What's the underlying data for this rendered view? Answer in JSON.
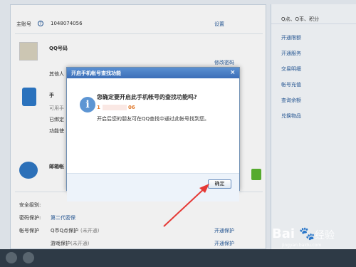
{
  "account": {
    "label": "主账号",
    "help": "?",
    "number": "1048074056",
    "settings_link": "设置"
  },
  "qq_row": {
    "title": "QQ号码",
    "sub": "其他人",
    "link": "修改密码"
  },
  "phone_row": {
    "name_prefix": "手",
    "lines": [
      "可用手",
      "已绑定",
      "功能使"
    ]
  },
  "mail_row": {
    "title": "邮箱帐"
  },
  "security": {
    "level_label": "安全级别:",
    "pwd_protect_label": "密码保护:",
    "pwd_protect_value": "第二代密保",
    "account_protect_label": "帐号保护",
    "items": [
      {
        "name": "Q币Q点保护",
        "status": "(未开通)",
        "action": "开通保护"
      },
      {
        "name": "游戏保护",
        "status": "(未开通)",
        "action": "开通保护"
      }
    ]
  },
  "right_panel": {
    "header": "Q点、Q币、积分",
    "items": [
      "开通限额",
      "开通服务",
      "交易明细",
      "帐号充值",
      "查询余额",
      "兑换物品"
    ]
  },
  "dialog": {
    "title": "开启手机帐号查找功能",
    "close": "×",
    "question": "您确定要开启此手机帐号的查找功能吗?",
    "phone_start": "1",
    "phone_end": "06",
    "description": "开启后您的朋友可在QQ查找中通过此帐号找到您。",
    "confirm": "确定"
  },
  "watermark": {
    "logo": "Bai",
    "paw": "🐾",
    "text": "经验",
    "url": "jingyan.baidu.com"
  },
  "colors": {
    "accent": "#2a5d9c",
    "dialog_title": "#4a80c4",
    "orange": "#e07a2e",
    "arrow": "#e53935"
  }
}
